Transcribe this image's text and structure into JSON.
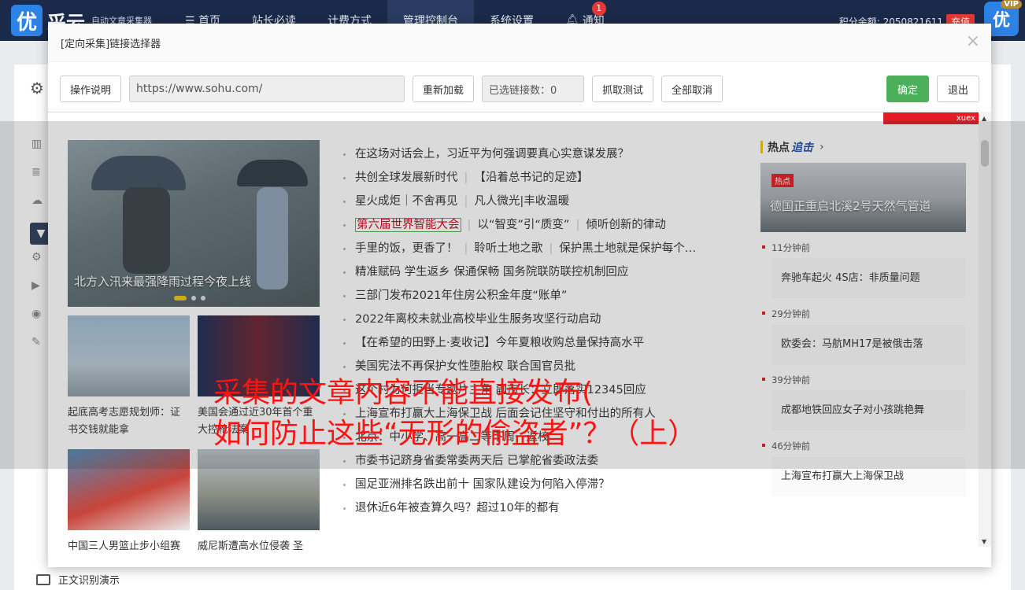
{
  "topbar": {
    "logo_char": "优",
    "logo_text": "采云",
    "logo_sub": "自动文章采集器",
    "nav": [
      "☰ 首页",
      "站长必读",
      "计费方式",
      "管理控制台",
      "系统设置",
      "通知"
    ],
    "notify_count": "1",
    "points_text": "积分余额: 2050821611",
    "recharge_label": "充值",
    "vip_char": "优",
    "vip_label": "VIP"
  },
  "background": {
    "bottom_label": "正文识别演示"
  },
  "dialog": {
    "title": "[定向采集]链接选择器",
    "close": "×",
    "buttons": {
      "help": "操作说明",
      "reload": "重新加载",
      "count": "已选链接数：0",
      "test": "抓取测试",
      "cancel_all": "全部取消",
      "ok": "确定",
      "exit": "退出"
    },
    "url": "https://www.sohu.com/"
  },
  "page": {
    "banner_text": "xuex",
    "hero_caption": "北方入汛来最强降雨过程今夜上线",
    "thumbs": [
      {
        "caption": "起底高考志愿规划师：证书交钱就能拿"
      },
      {
        "caption": "美国会通过近30年首个重大控枪法案"
      },
      {
        "caption": "中国三人男篮止步小组赛"
      },
      {
        "caption": "威尼斯遭高水位侵袭 圣"
      }
    ],
    "news": [
      [
        "在这场对话会上，习近平为何强调要真心实意谋发展？"
      ],
      [
        "共创全球发展新时代",
        "【沿着总书记的足迹】"
      ],
      [
        "星火成炬｜不舍再见",
        "凡人微光|丰收温暖"
      ],
      [
        "第六届世界智能大会",
        "以“智变”引“质变”",
        "倾听创新的律动"
      ],
      [
        "手里的饭，更香了！",
        "聆听土地之歌",
        "保护黑土地就是保护每个…"
      ],
      [
        "精准赋码 学生返乡 保通保畅 国务院联防联控机制回应"
      ],
      [
        "三部门发布2021年住房公积金年度“账单”"
      ],
      [
        "2022年离校未就业高校毕业生服务攻坚行动启动"
      ],
      [
        "【在希望的田野上·麦收记】今年夏粮收购总量保持高水平"
      ],
      [
        "美国宪法不再保护女性堕胎权 联合国官员批"
      ],
      [
        "这个村为何拒当专题片主角 副市长：立即落实12345回应"
      ],
      [
        "上海宣布打赢大上海保卫战 后面会记住坚守和付出的所有人"
      ],
      [
        "北京：中小学、高一高二等下周一返校"
      ],
      [
        "市委书记跻身省委常委两天后 已掌舵省委政法委"
      ],
      [
        "国足亚洲排名跌出前十 国家队建设为何陷入停滞？"
      ],
      [
        "退休近6年被查算久吗？超过10年的都有"
      ]
    ],
    "hot": {
      "head_a": "热点",
      "head_b": "追击",
      "arrow": "›",
      "img_tag": "热点",
      "img_title": "德国正重启北溪2号天然气管道",
      "items": [
        {
          "time": "11分钟前",
          "title": "奔驰车起火 4S店：非质量问题"
        },
        {
          "time": "29分钟前",
          "title": "欧委会：马航MH17是被俄击落"
        },
        {
          "time": "39分钟前",
          "title": "成都地铁回应女子对小孩跳艳舞"
        },
        {
          "time": "46分钟前",
          "title": "上海宣布打赢大上海保卫战"
        }
      ]
    }
  },
  "watermark": {
    "line1": "采集的文章内容不能直接发布(",
    "line2": "如何防止这些“无形的偷盗者”？（上）"
  },
  "colors": {
    "nav_bg": "#1b2a4a",
    "ok_green": "#4cb05a",
    "watermark_red": "#ff1212",
    "accent_red": "#e21b25"
  }
}
